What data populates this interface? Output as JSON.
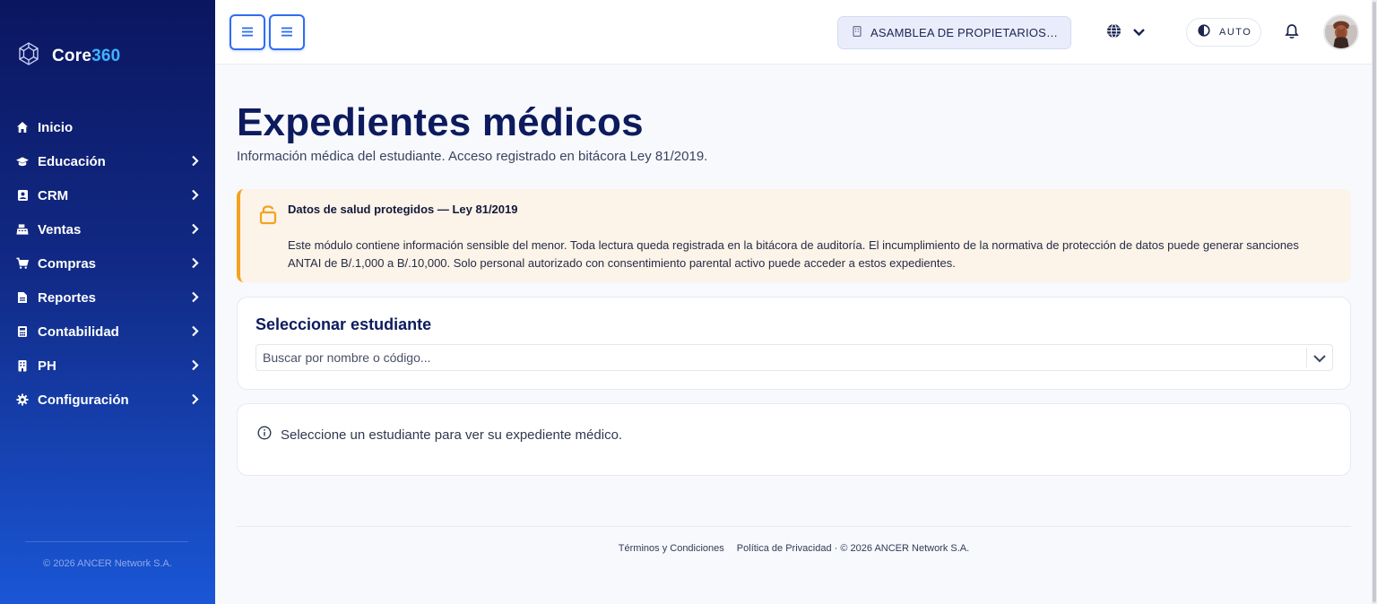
{
  "brand": {
    "name_main": "Core",
    "name_accent": "360",
    "accent_color": "#3fb3ff"
  },
  "sidebar": {
    "items": [
      {
        "label": "Inicio",
        "icon": "home-icon",
        "has_submenu": false
      },
      {
        "label": "Educación",
        "icon": "graduation-cap-icon",
        "has_submenu": true
      },
      {
        "label": "CRM",
        "icon": "contact-book-icon",
        "has_submenu": true
      },
      {
        "label": "Ventas",
        "icon": "cash-register-icon",
        "has_submenu": true
      },
      {
        "label": "Compras",
        "icon": "cart-icon",
        "has_submenu": true
      },
      {
        "label": "Reportes",
        "icon": "file-report-icon",
        "has_submenu": true
      },
      {
        "label": "Contabilidad",
        "icon": "calculator-icon",
        "has_submenu": true
      },
      {
        "label": "PH",
        "icon": "building-icon",
        "has_submenu": true
      },
      {
        "label": "Configuración",
        "icon": "gear-icon",
        "has_submenu": true
      }
    ],
    "footer": "© 2026 ANCER Network S.A."
  },
  "topbar": {
    "organization": "ASAMBLEA DE PROPIETARIOS DE ...",
    "theme_mode": "AUTO"
  },
  "page": {
    "title": "Expedientes médicos",
    "subtitle": "Información médica del estudiante. Acceso registrado en bitácora Ley 81/2019."
  },
  "alert": {
    "title": "Datos de salud protegidos — Ley 81/2019",
    "body": "Este módulo contiene información sensible del menor. Toda lectura queda registrada en la bitácora de auditoría. El incumplimiento de la normativa de protección de datos puede generar sanciones ANTAI de B/.1,000 a B/.10,000. Solo personal autorizado con consentimiento parental activo puede acceder a estos expedientes.",
    "color": "#f4a21e"
  },
  "student_select": {
    "title": "Seleccionar estudiante",
    "placeholder": "Buscar por nombre o código..."
  },
  "empty_state": "Seleccione un estudiante para ver su expediente médico.",
  "footer": {
    "terms": "Términos y Condiciones",
    "privacy": "Política de Privacidad",
    "copyright": "· © 2026 ANCER Network S.A."
  },
  "colors": {
    "primary": "#2f6df0",
    "heading": "#0d1b5e",
    "sidebar_top": "#0b1660",
    "sidebar_bottom": "#1a56d6"
  }
}
